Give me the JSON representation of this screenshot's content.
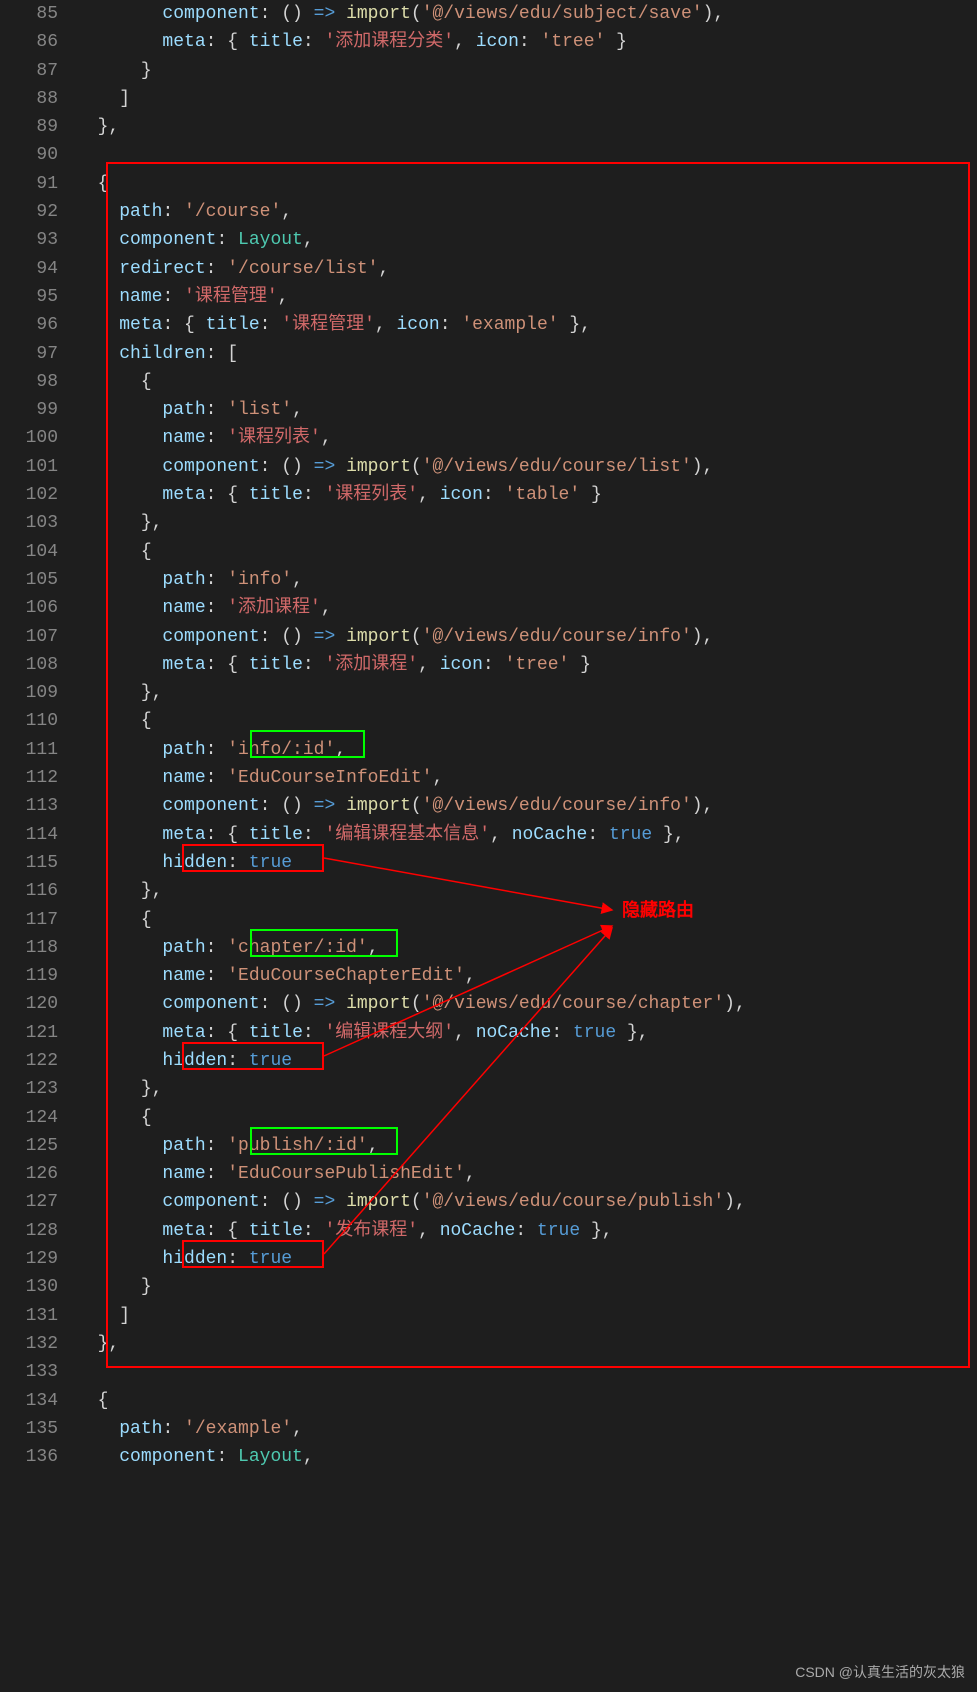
{
  "startLine": 85,
  "endLineLabel": "136",
  "watermark": "CSDN @认真生活的灰太狼",
  "annotation": {
    "label": "隐藏路由"
  },
  "lines": [
    [
      [
        "",
        "        "
      ],
      [
        "tok-key",
        "component"
      ],
      [
        "tok-punc",
        ": () "
      ],
      [
        "tok-arrow",
        "=>"
      ],
      [
        "tok-punc",
        " "
      ],
      [
        "tok-fn",
        "import"
      ],
      [
        "tok-punc",
        "("
      ],
      [
        "tok-str",
        "'@/views/edu/subject/save'"
      ],
      [
        "tok-punc",
        "),"
      ]
    ],
    [
      [
        "",
        "        "
      ],
      [
        "tok-key",
        "meta"
      ],
      [
        "tok-punc",
        ": { "
      ],
      [
        "tok-key",
        "title"
      ],
      [
        "tok-punc",
        ": "
      ],
      [
        "tok-strc",
        "'添加课程分类'"
      ],
      [
        "tok-punc",
        ", "
      ],
      [
        "tok-key",
        "icon"
      ],
      [
        "tok-punc",
        ": "
      ],
      [
        "tok-str",
        "'tree'"
      ],
      [
        "tok-punc",
        " }"
      ]
    ],
    [
      [
        "",
        "      "
      ],
      [
        "tok-punc",
        "}"
      ]
    ],
    [
      [
        "",
        "    "
      ],
      [
        "tok-punc",
        "]"
      ]
    ],
    [
      [
        "",
        "  "
      ],
      [
        "tok-punc",
        "},"
      ]
    ],
    [
      [
        "",
        ""
      ]
    ],
    [
      [
        "",
        "  "
      ],
      [
        "tok-punc",
        "{"
      ]
    ],
    [
      [
        "",
        "    "
      ],
      [
        "tok-key",
        "path"
      ],
      [
        "tok-punc",
        ": "
      ],
      [
        "tok-str",
        "'/course'"
      ],
      [
        "tok-punc",
        ","
      ]
    ],
    [
      [
        "",
        "    "
      ],
      [
        "tok-key",
        "component"
      ],
      [
        "tok-punc",
        ": "
      ],
      [
        "tok-type",
        "Layout"
      ],
      [
        "tok-punc",
        ","
      ]
    ],
    [
      [
        "",
        "    "
      ],
      [
        "tok-key",
        "redirect"
      ],
      [
        "tok-punc",
        ": "
      ],
      [
        "tok-str",
        "'/course/list'"
      ],
      [
        "tok-punc",
        ","
      ]
    ],
    [
      [
        "",
        "    "
      ],
      [
        "tok-key",
        "name"
      ],
      [
        "tok-punc",
        ": "
      ],
      [
        "tok-strc",
        "'课程管理'"
      ],
      [
        "tok-punc",
        ","
      ]
    ],
    [
      [
        "",
        "    "
      ],
      [
        "tok-key",
        "meta"
      ],
      [
        "tok-punc",
        ": { "
      ],
      [
        "tok-key",
        "title"
      ],
      [
        "tok-punc",
        ": "
      ],
      [
        "tok-strc",
        "'课程管理'"
      ],
      [
        "tok-punc",
        ", "
      ],
      [
        "tok-key",
        "icon"
      ],
      [
        "tok-punc",
        ": "
      ],
      [
        "tok-str",
        "'example'"
      ],
      [
        "tok-punc",
        " },"
      ]
    ],
    [
      [
        "",
        "    "
      ],
      [
        "tok-key",
        "children"
      ],
      [
        "tok-punc",
        ": ["
      ]
    ],
    [
      [
        "",
        "      "
      ],
      [
        "tok-punc",
        "{"
      ]
    ],
    [
      [
        "",
        "        "
      ],
      [
        "tok-key",
        "path"
      ],
      [
        "tok-punc",
        ": "
      ],
      [
        "tok-str",
        "'list'"
      ],
      [
        "tok-punc",
        ","
      ]
    ],
    [
      [
        "",
        "        "
      ],
      [
        "tok-key",
        "name"
      ],
      [
        "tok-punc",
        ": "
      ],
      [
        "tok-strc",
        "'课程列表'"
      ],
      [
        "tok-punc",
        ","
      ]
    ],
    [
      [
        "",
        "        "
      ],
      [
        "tok-key",
        "component"
      ],
      [
        "tok-punc",
        ": () "
      ],
      [
        "tok-arrow",
        "=>"
      ],
      [
        "tok-punc",
        " "
      ],
      [
        "tok-fn",
        "import"
      ],
      [
        "tok-punc",
        "("
      ],
      [
        "tok-str",
        "'@/views/edu/course/list'"
      ],
      [
        "tok-punc",
        "),"
      ]
    ],
    [
      [
        "",
        "        "
      ],
      [
        "tok-key",
        "meta"
      ],
      [
        "tok-punc",
        ": { "
      ],
      [
        "tok-key",
        "title"
      ],
      [
        "tok-punc",
        ": "
      ],
      [
        "tok-strc",
        "'课程列表'"
      ],
      [
        "tok-punc",
        ", "
      ],
      [
        "tok-key",
        "icon"
      ],
      [
        "tok-punc",
        ": "
      ],
      [
        "tok-str",
        "'table'"
      ],
      [
        "tok-punc",
        " }"
      ]
    ],
    [
      [
        "",
        "      "
      ],
      [
        "tok-punc",
        "},"
      ]
    ],
    [
      [
        "",
        "      "
      ],
      [
        "tok-punc",
        "{"
      ]
    ],
    [
      [
        "",
        "        "
      ],
      [
        "tok-key",
        "path"
      ],
      [
        "tok-punc",
        ": "
      ],
      [
        "tok-str",
        "'info'"
      ],
      [
        "tok-punc",
        ","
      ]
    ],
    [
      [
        "",
        "        "
      ],
      [
        "tok-key",
        "name"
      ],
      [
        "tok-punc",
        ": "
      ],
      [
        "tok-strc",
        "'添加课程'"
      ],
      [
        "tok-punc",
        ","
      ]
    ],
    [
      [
        "",
        "        "
      ],
      [
        "tok-key",
        "component"
      ],
      [
        "tok-punc",
        ": () "
      ],
      [
        "tok-arrow",
        "=>"
      ],
      [
        "tok-punc",
        " "
      ],
      [
        "tok-fn",
        "import"
      ],
      [
        "tok-punc",
        "("
      ],
      [
        "tok-str",
        "'@/views/edu/course/info'"
      ],
      [
        "tok-punc",
        "),"
      ]
    ],
    [
      [
        "",
        "        "
      ],
      [
        "tok-key",
        "meta"
      ],
      [
        "tok-punc",
        ": { "
      ],
      [
        "tok-key",
        "title"
      ],
      [
        "tok-punc",
        ": "
      ],
      [
        "tok-strc",
        "'添加课程'"
      ],
      [
        "tok-punc",
        ", "
      ],
      [
        "tok-key",
        "icon"
      ],
      [
        "tok-punc",
        ": "
      ],
      [
        "tok-str",
        "'tree'"
      ],
      [
        "tok-punc",
        " }"
      ]
    ],
    [
      [
        "",
        "      "
      ],
      [
        "tok-punc",
        "},"
      ]
    ],
    [
      [
        "",
        "      "
      ],
      [
        "tok-punc",
        "{"
      ]
    ],
    [
      [
        "",
        "        "
      ],
      [
        "tok-key",
        "path"
      ],
      [
        "tok-punc",
        ": "
      ],
      [
        "tok-str",
        "'info/:id'"
      ],
      [
        "tok-punc",
        ","
      ]
    ],
    [
      [
        "",
        "        "
      ],
      [
        "tok-key",
        "name"
      ],
      [
        "tok-punc",
        ": "
      ],
      [
        "tok-str",
        "'EduCourseInfoEdit'"
      ],
      [
        "tok-punc",
        ","
      ]
    ],
    [
      [
        "",
        "        "
      ],
      [
        "tok-key",
        "component"
      ],
      [
        "tok-punc",
        ": () "
      ],
      [
        "tok-arrow",
        "=>"
      ],
      [
        "tok-punc",
        " "
      ],
      [
        "tok-fn",
        "import"
      ],
      [
        "tok-punc",
        "("
      ],
      [
        "tok-str",
        "'@/views/edu/course/info'"
      ],
      [
        "tok-punc",
        "),"
      ]
    ],
    [
      [
        "",
        "        "
      ],
      [
        "tok-key",
        "meta"
      ],
      [
        "tok-punc",
        ": { "
      ],
      [
        "tok-key",
        "title"
      ],
      [
        "tok-punc",
        ": "
      ],
      [
        "tok-strc",
        "'编辑课程基本信息'"
      ],
      [
        "tok-punc",
        ", "
      ],
      [
        "tok-key",
        "noCache"
      ],
      [
        "tok-punc",
        ": "
      ],
      [
        "tok-bool",
        "true"
      ],
      [
        "tok-punc",
        " },"
      ]
    ],
    [
      [
        "",
        "        "
      ],
      [
        "tok-key",
        "hidden"
      ],
      [
        "tok-punc",
        ": "
      ],
      [
        "tok-bool",
        "true"
      ]
    ],
    [
      [
        "",
        "      "
      ],
      [
        "tok-punc",
        "},"
      ]
    ],
    [
      [
        "",
        "      "
      ],
      [
        "tok-punc",
        "{"
      ]
    ],
    [
      [
        "",
        "        "
      ],
      [
        "tok-key",
        "path"
      ],
      [
        "tok-punc",
        ": "
      ],
      [
        "tok-str",
        "'chapter/:id'"
      ],
      [
        "tok-punc",
        ","
      ]
    ],
    [
      [
        "",
        "        "
      ],
      [
        "tok-key",
        "name"
      ],
      [
        "tok-punc",
        ": "
      ],
      [
        "tok-str",
        "'EduCourseChapterEdit'"
      ],
      [
        "tok-punc",
        ","
      ]
    ],
    [
      [
        "",
        "        "
      ],
      [
        "tok-key",
        "component"
      ],
      [
        "tok-punc",
        ": () "
      ],
      [
        "tok-arrow",
        "=>"
      ],
      [
        "tok-punc",
        " "
      ],
      [
        "tok-fn",
        "import"
      ],
      [
        "tok-punc",
        "("
      ],
      [
        "tok-str",
        "'@/views/edu/course/chapter'"
      ],
      [
        "tok-punc",
        "),"
      ]
    ],
    [
      [
        "",
        "        "
      ],
      [
        "tok-key",
        "meta"
      ],
      [
        "tok-punc",
        ": { "
      ],
      [
        "tok-key",
        "title"
      ],
      [
        "tok-punc",
        ": "
      ],
      [
        "tok-strc",
        "'编辑课程大纲'"
      ],
      [
        "tok-punc",
        ", "
      ],
      [
        "tok-key",
        "noCache"
      ],
      [
        "tok-punc",
        ": "
      ],
      [
        "tok-bool",
        "true"
      ],
      [
        "tok-punc",
        " },"
      ]
    ],
    [
      [
        "",
        "        "
      ],
      [
        "tok-key",
        "hidden"
      ],
      [
        "tok-punc",
        ": "
      ],
      [
        "tok-bool",
        "true"
      ]
    ],
    [
      [
        "",
        "      "
      ],
      [
        "tok-punc",
        "},"
      ]
    ],
    [
      [
        "",
        "      "
      ],
      [
        "tok-punc",
        "{"
      ]
    ],
    [
      [
        "",
        "        "
      ],
      [
        "tok-key",
        "path"
      ],
      [
        "tok-punc",
        ": "
      ],
      [
        "tok-str",
        "'publish/:id'"
      ],
      [
        "tok-punc",
        ","
      ]
    ],
    [
      [
        "",
        "        "
      ],
      [
        "tok-key",
        "name"
      ],
      [
        "tok-punc",
        ": "
      ],
      [
        "tok-str",
        "'EduCoursePublishEdit'"
      ],
      [
        "tok-punc",
        ","
      ]
    ],
    [
      [
        "",
        "        "
      ],
      [
        "tok-key",
        "component"
      ],
      [
        "tok-punc",
        ": () "
      ],
      [
        "tok-arrow",
        "=>"
      ],
      [
        "tok-punc",
        " "
      ],
      [
        "tok-fn",
        "import"
      ],
      [
        "tok-punc",
        "("
      ],
      [
        "tok-str",
        "'@/views/edu/course/publish'"
      ],
      [
        "tok-punc",
        "),"
      ]
    ],
    [
      [
        "",
        "        "
      ],
      [
        "tok-key",
        "meta"
      ],
      [
        "tok-punc",
        ": { "
      ],
      [
        "tok-key",
        "title"
      ],
      [
        "tok-punc",
        ": "
      ],
      [
        "tok-strc",
        "'发布课程'"
      ],
      [
        "tok-punc",
        ", "
      ],
      [
        "tok-key",
        "noCache"
      ],
      [
        "tok-punc",
        ": "
      ],
      [
        "tok-bool",
        "true"
      ],
      [
        "tok-punc",
        " },"
      ]
    ],
    [
      [
        "",
        "        "
      ],
      [
        "tok-key",
        "hidden"
      ],
      [
        "tok-punc",
        ": "
      ],
      [
        "tok-bool",
        "true"
      ]
    ],
    [
      [
        "",
        "      "
      ],
      [
        "tok-punc",
        "}"
      ]
    ],
    [
      [
        "",
        "    "
      ],
      [
        "tok-punc",
        "]"
      ]
    ],
    [
      [
        "",
        "  "
      ],
      [
        "tok-punc",
        "},"
      ]
    ],
    [
      [
        "",
        ""
      ]
    ],
    [
      [
        "",
        "  "
      ],
      [
        "tok-punc",
        "{"
      ]
    ],
    [
      [
        "",
        "    "
      ],
      [
        "tok-key",
        "path"
      ],
      [
        "tok-punc",
        ": "
      ],
      [
        "tok-str",
        "'/example'"
      ],
      [
        "tok-punc",
        ","
      ]
    ],
    [
      [
        "",
        "    "
      ],
      [
        "tok-key",
        "component"
      ],
      [
        "tok-punc",
        ": "
      ],
      [
        "tok-type",
        "Layout"
      ],
      [
        "tok-punc",
        ","
      ]
    ]
  ]
}
